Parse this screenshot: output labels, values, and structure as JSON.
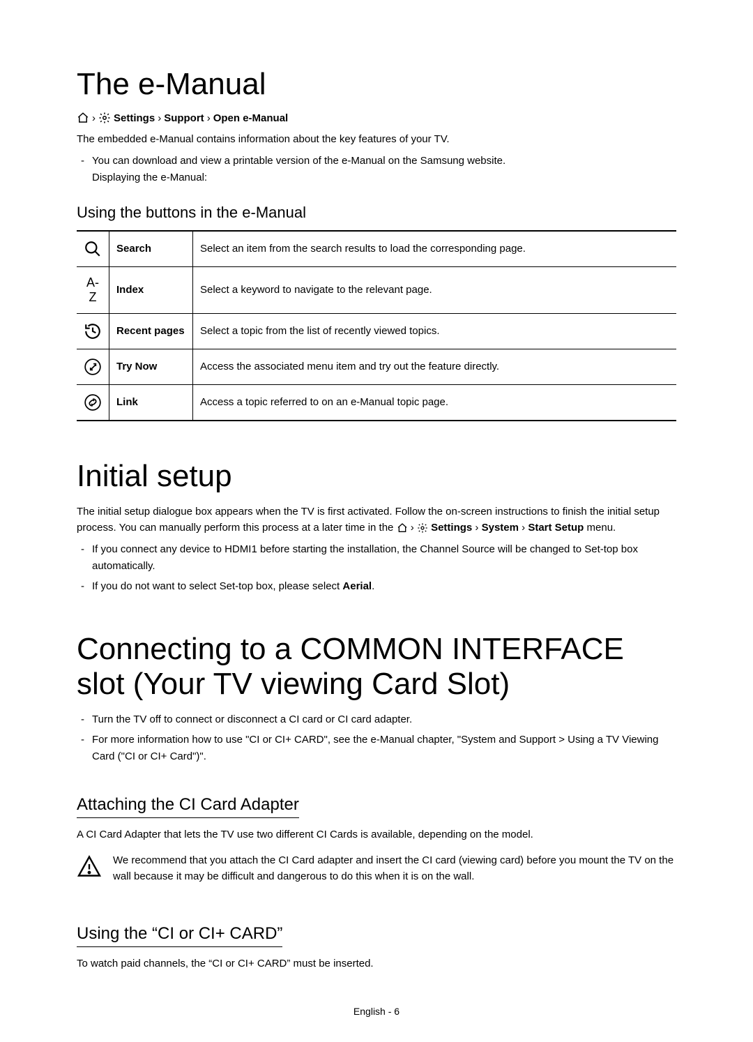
{
  "section_emanual": {
    "title": "The e-Manual",
    "breadcrumb": [
      "Settings",
      "Support",
      "Open e-Manual"
    ],
    "intro": "The embedded e-Manual contains information about the key features of your TV.",
    "bullets": [
      "You can download and view a printable version of the e-Manual on the Samsung website."
    ],
    "post_bullet_line": "Displaying the e-Manual:",
    "buttons_heading": "Using the buttons in the e-Manual",
    "buttons": [
      {
        "name": "Search",
        "desc": "Select an item from the search results to load the corresponding page."
      },
      {
        "name": "Index",
        "desc": "Select a keyword to navigate to the relevant page."
      },
      {
        "name": "Recent pages",
        "desc": "Select a topic from the list of recently viewed topics."
      },
      {
        "name": "Try Now",
        "desc": "Access the associated menu item and try out the feature directly."
      },
      {
        "name": "Link",
        "desc": "Access a topic referred to on an e-Manual topic page."
      }
    ]
  },
  "section_initial": {
    "title": "Initial setup",
    "para_a": "The initial setup dialogue box appears when the TV is first activated. Follow the on-screen instructions to finish the initial setup process. You can manually perform this process at a later time in the ",
    "para_b_path": [
      "Settings",
      "System",
      "Start Setup"
    ],
    "para_c": " menu.",
    "bullets": [
      "If you connect any device to HDMI1 before starting the installation, the Channel Source will be changed to Set-top box automatically.",
      "If you do not want to select Set-top box, please select "
    ],
    "aerial": "Aerial",
    "period": "."
  },
  "section_ci": {
    "title": "Connecting to a COMMON INTERFACE slot (Your TV viewing Card Slot)",
    "bullets": [
      "Turn the TV off to connect or disconnect a CI card or CI card adapter.",
      "For more information how to use \"CI or CI+ CARD\", see the e-Manual chapter, \"System and Support > Using a TV Viewing Card (\"CI or CI+ Card\")\"."
    ],
    "attach_heading": "Attaching the CI Card Adapter",
    "attach_para": "A CI Card Adapter that lets the TV use two different CI Cards is available, depending on the model.",
    "attach_warn": "We recommend that you attach the CI Card adapter and insert the CI card (viewing card) before you mount the TV on the wall because it may be difficult and dangerous to do this when it is on the wall.",
    "using_heading": "Using the “CI or CI+ CARD”",
    "using_para": "To watch paid channels, the “CI or CI+ CARD” must be inserted."
  },
  "footer": "English - 6"
}
